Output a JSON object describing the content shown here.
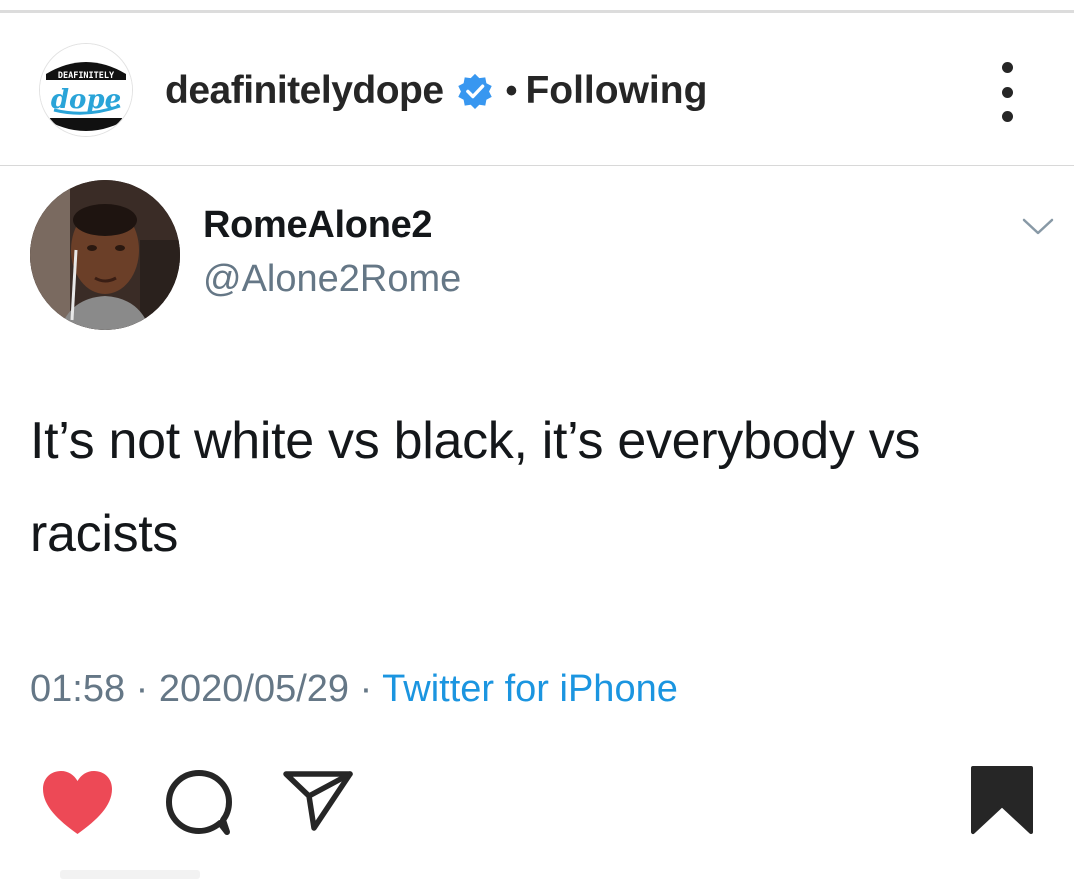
{
  "post_header": {
    "account_name": "deafinitelydope",
    "separator": "•",
    "follow_status": "Following",
    "logo_text_top": "DEAFINITELY",
    "logo_text_main": "dope",
    "verified_icon": "verified-badge-icon",
    "more_icon": "more-vertical-icon"
  },
  "tweet": {
    "display_name": "RomeAlone2",
    "handle": "@Alone2Rome",
    "text": "It’s not white vs black, it’s everybody vs racists",
    "time": "01:58",
    "date": "2020/05/29",
    "meta_sep": "·",
    "source": "Twitter for iPhone",
    "menu_icon": "chevron-down-icon"
  },
  "actions": {
    "like_icon": "heart-icon",
    "liked": true,
    "comment_icon": "comment-icon",
    "share_icon": "send-icon",
    "save_icon": "bookmark-icon",
    "saved": true
  },
  "colors": {
    "text_primary": "#14171a",
    "text_secondary": "#657786",
    "link": "#1b95e0",
    "verified": "#3897f0",
    "like_red": "#ed4956",
    "ig_text": "#262626"
  }
}
